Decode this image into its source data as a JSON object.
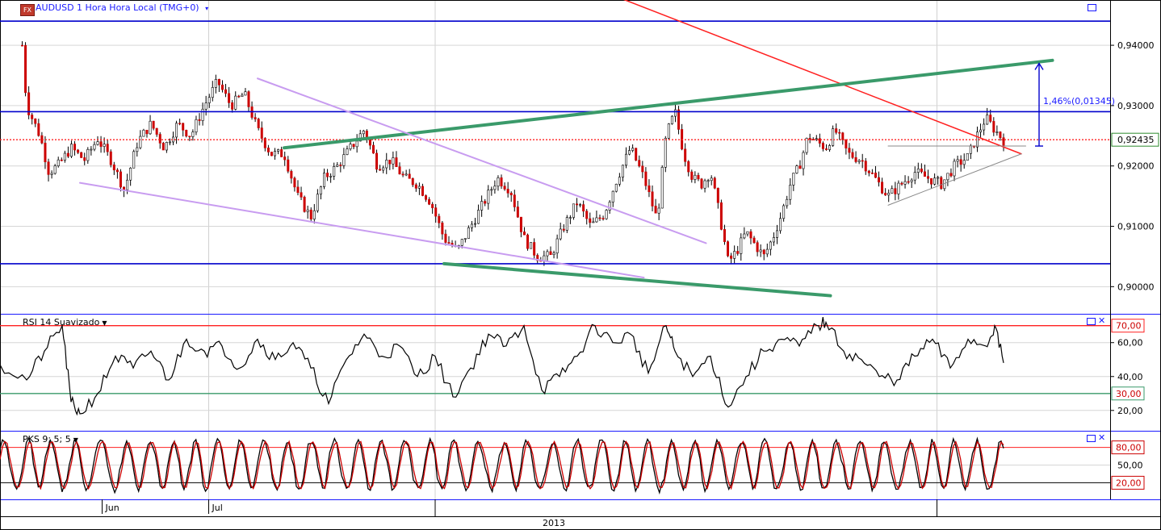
{
  "main_title": "AUDUSD 1 Hora Hora Local (TMG+0)",
  "main_title_caret": "▾",
  "fx_badge": "FX",
  "current_price_tag": "0,92435",
  "measure_label": "1,46%(0,01345)",
  "rsi_title": "RSI 14 Suavizado",
  "pks_title": "PKS 9; 5; 5",
  "colors": {
    "price_up": "#000000",
    "price_down": "#cc0000",
    "blue_hline": "#0000cc",
    "red_trend": "#ff2020",
    "green_trend": "#3a9a6a",
    "violet_trend": "#c89cf0",
    "rsi_upper": "#ff0000",
    "rsi_lower": "#008000",
    "pks_k": "#000000",
    "pks_d": "#cc0000"
  },
  "chart_data": [
    {
      "type": "candlestick",
      "title": "AUDUSD 1 Hora Hora Local (TMG+0)",
      "ylim": [
        0.8955,
        0.9475
      ],
      "y_ticks": [
        "0,90000",
        "0,91000",
        "0,92000",
        "0,93000",
        "0,94000"
      ],
      "y_tick_values": [
        0.9,
        0.91,
        0.92,
        0.93,
        0.94
      ],
      "x_labels": [
        "Jun",
        "Jul"
      ],
      "x_group_label": "2013",
      "last_price": 0.92435,
      "price_path": [
        [
          0.0,
          0.946
        ],
        [
          1.2,
          0.947
        ],
        [
          2.3,
          0.944
        ],
        [
          3.0,
          0.93
        ],
        [
          4.5,
          0.925
        ],
        [
          5.5,
          0.919
        ],
        [
          6.5,
          0.92
        ],
        [
          8.0,
          0.923
        ],
        [
          9.5,
          0.921
        ],
        [
          11.0,
          0.9245
        ],
        [
          12.5,
          0.921
        ],
        [
          14.0,
          0.916
        ],
        [
          15.5,
          0.924
        ],
        [
          17.0,
          0.927
        ],
        [
          18.5,
          0.923
        ],
        [
          20.0,
          0.927
        ],
        [
          21.5,
          0.925
        ],
        [
          23.0,
          0.93
        ],
        [
          24.5,
          0.934
        ],
        [
          26.0,
          0.93
        ],
        [
          27.5,
          0.932
        ],
        [
          29.0,
          0.926
        ],
        [
          30.5,
          0.922
        ],
        [
          32.0,
          0.922
        ],
        [
          33.5,
          0.915
        ],
        [
          35.0,
          0.9115
        ],
        [
          36.5,
          0.918
        ],
        [
          38.0,
          0.92
        ],
        [
          39.5,
          0.923
        ],
        [
          41.0,
          0.926
        ],
        [
          42.5,
          0.92
        ],
        [
          44.0,
          0.921
        ],
        [
          45.5,
          0.918
        ],
        [
          47.0,
          0.917
        ],
        [
          48.5,
          0.914
        ],
        [
          50.0,
          0.908
        ],
        [
          51.5,
          0.906
        ],
        [
          53.0,
          0.91
        ],
        [
          54.5,
          0.914
        ],
        [
          56.0,
          0.918
        ],
        [
          57.5,
          0.916
        ],
        [
          59.0,
          0.908
        ],
        [
          60.5,
          0.905
        ],
        [
          62.0,
          0.905
        ],
        [
          63.5,
          0.91
        ],
        [
          65.0,
          0.914
        ],
        [
          66.5,
          0.91
        ],
        [
          68.0,
          0.912
        ],
        [
          69.5,
          0.918
        ],
        [
          71.0,
          0.923
        ],
        [
          72.5,
          0.918
        ],
        [
          74.0,
          0.911
        ],
        [
          75.0,
          0.925
        ],
        [
          76.0,
          0.929
        ],
        [
          77.0,
          0.922
        ],
        [
          78.0,
          0.918
        ],
        [
          79.0,
          0.917
        ],
        [
          80.0,
          0.919
        ],
        [
          81.0,
          0.912
        ],
        [
          82.0,
          0.904
        ],
        [
          83.0,
          0.906
        ],
        [
          84.0,
          0.909
        ],
        [
          85.0,
          0.907
        ],
        [
          86.0,
          0.905
        ],
        [
          87.0,
          0.908
        ],
        [
          88.0,
          0.912
        ],
        [
          89.0,
          0.917
        ],
        [
          90.0,
          0.92
        ],
        [
          91.0,
          0.925
        ],
        [
          92.0,
          0.924
        ],
        [
          93.0,
          0.923
        ],
        [
          94.0,
          0.926
        ],
        [
          95.5,
          0.922
        ],
        [
          97.0,
          0.921
        ],
        [
          98.5,
          0.918
        ],
        [
          100.0,
          0.915
        ],
        [
          101.5,
          0.917
        ],
        [
          103.0,
          0.919
        ],
        [
          104.5,
          0.918
        ],
        [
          106.0,
          0.917
        ],
        [
          107.5,
          0.92
        ],
        [
          109.0,
          0.9215
        ],
        [
          110.0,
          0.925
        ],
        [
          111.0,
          0.928
        ],
        [
          112.0,
          0.926
        ],
        [
          113.0,
          0.9243
        ]
      ],
      "horizontal_lines": [
        {
          "price": 0.944,
          "color": "blue"
        },
        {
          "price": 0.929,
          "color": "blue"
        },
        {
          "price": 0.9038,
          "color": "blue"
        },
        {
          "price": 0.92435,
          "color": "red",
          "style": "dotted"
        }
      ],
      "trendlines": [
        {
          "color": "red",
          "from": [
            48.5,
            0.96
          ],
          "to": [
            115.0,
            0.922
          ]
        },
        {
          "color": "green",
          "from": [
            32.0,
            0.923
          ],
          "to": [
            118.5,
            0.9375
          ]
        },
        {
          "color": "green",
          "from": [
            50.0,
            0.9038
          ],
          "to": [
            93.5,
            0.8985
          ]
        },
        {
          "color": "violet",
          "from": [
            9.0,
            0.9172
          ],
          "to": [
            72.5,
            0.9015
          ]
        },
        {
          "color": "violet",
          "from": [
            29.0,
            0.9345
          ],
          "to": [
            79.5,
            0.9072
          ]
        },
        {
          "color": "grey",
          "from": [
            100.0,
            0.9135
          ],
          "to": [
            115.0,
            0.922
          ]
        },
        {
          "color": "grey",
          "from": [
            100.0,
            0.9233
          ],
          "to": [
            115.5,
            0.9233
          ]
        }
      ],
      "measure": {
        "label": "1,46%(0,01345)",
        "from_price": 0.9233,
        "to_price": 0.937,
        "x": 117.0
      }
    },
    {
      "type": "line",
      "title": "RSI 14 Suavizado",
      "ylim": [
        8,
        77
      ],
      "y_ticks": [
        "20,00",
        "40,00",
        "60,00"
      ],
      "y_tick_values": [
        20,
        40,
        60
      ],
      "levels": [
        {
          "value": 70,
          "label": "70,00",
          "color": "red"
        },
        {
          "value": 30,
          "label": "30,00",
          "color": "green"
        }
      ],
      "last_value": 48,
      "path": [
        [
          0,
          47
        ],
        [
          3,
          38
        ],
        [
          5,
          55
        ],
        [
          7,
          70
        ],
        [
          8,
          25
        ],
        [
          9,
          18
        ],
        [
          11,
          30
        ],
        [
          13,
          52
        ],
        [
          15,
          45
        ],
        [
          17,
          55
        ],
        [
          19,
          38
        ],
        [
          21,
          62
        ],
        [
          23,
          55
        ],
        [
          25,
          58
        ],
        [
          27,
          45
        ],
        [
          29,
          62
        ],
        [
          31,
          50
        ],
        [
          33,
          60
        ],
        [
          35,
          45
        ],
        [
          37,
          24
        ],
        [
          39,
          50
        ],
        [
          41,
          65
        ],
        [
          43,
          52
        ],
        [
          45,
          58
        ],
        [
          47,
          40
        ],
        [
          49,
          52
        ],
        [
          51,
          28
        ],
        [
          53,
          45
        ],
        [
          55,
          65
        ],
        [
          57,
          58
        ],
        [
          59,
          70
        ],
        [
          61,
          32
        ],
        [
          63,
          40
        ],
        [
          65,
          52
        ],
        [
          67,
          70
        ],
        [
          69,
          60
        ],
        [
          71,
          65
        ],
        [
          73,
          42
        ],
        [
          75,
          70
        ],
        [
          76,
          55
        ],
        [
          78,
          40
        ],
        [
          80,
          52
        ],
        [
          82,
          22
        ],
        [
          84,
          40
        ],
        [
          86,
          55
        ],
        [
          88,
          62
        ],
        [
          90,
          58
        ],
        [
          92,
          70
        ],
        [
          93,
          72
        ],
        [
          95,
          55
        ],
        [
          97,
          50
        ],
        [
          99,
          40
        ],
        [
          101,
          38
        ],
        [
          103,
          52
        ],
        [
          105,
          62
        ],
        [
          107,
          45
        ],
        [
          109,
          62
        ],
        [
          111,
          58
        ],
        [
          112,
          70
        ],
        [
          113,
          48
        ]
      ]
    },
    {
      "type": "line",
      "title": "PKS 9; 5; 5",
      "ylim": [
        0,
        100
      ],
      "y_ticks": [
        "50,00"
      ],
      "y_tick_values": [
        50
      ],
      "levels": [
        {
          "value": 80,
          "label": "80,00",
          "color": "red"
        },
        {
          "value": 20,
          "label": "20,00",
          "color": "black"
        }
      ],
      "cycles_per_width": 42
    }
  ]
}
